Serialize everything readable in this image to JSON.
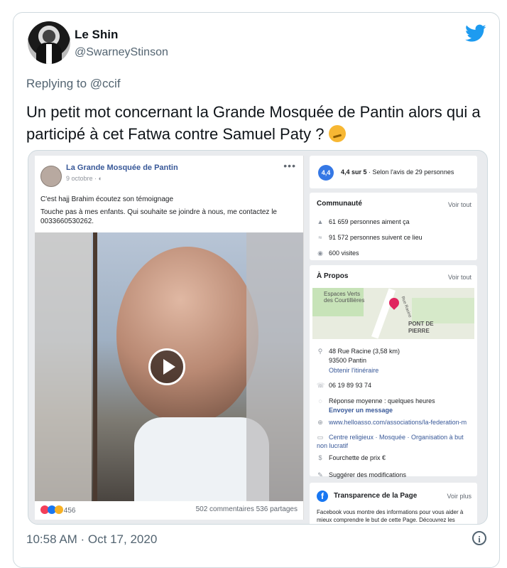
{
  "tweet": {
    "author_name": "Le Shin",
    "author_handle": "@SwarneyStinson",
    "replying_prefix": "Replying to ",
    "replying_to": "@ccif",
    "text": "Un petit mot concernant la Grande Mosquée de Pantin alors qui a participé à cet Fatwa contre Samuel Paty ?",
    "timestamp": "10:58 AM · Oct 17, 2020",
    "info_glyph": "i"
  },
  "screenshot": {
    "post": {
      "page_name": "La Grande Mosquée de Pantin",
      "date": "9 octobre · ",
      "menu": "•••",
      "line1": "C'est hajj Brahim écoutez son témoignage",
      "line2": "Touche pas à mes enfants. Qui souhaite se joindre à nous, me contactez le 0033660530262.",
      "reaction_count": "456",
      "counts": "502 commentaires  536 partages"
    },
    "rating": {
      "badge": "4,4",
      "score": "4,4 sur 5",
      "detail": " · Selon l'avis de 29 personnes"
    },
    "community": {
      "title": "Communauté",
      "see_all": "Voir tout",
      "likes": "61 659 personnes aiment ça",
      "follows": "91 572 personnes suivent ce lieu",
      "visits": "600 visites"
    },
    "about": {
      "title": "À Propos",
      "see_all": "Voir tout",
      "map_label_1": "Espaces Verts des Courtillières",
      "map_label_2": "PONT DE PIERRE",
      "map_label_3": "Rue Racine",
      "address": "48 Rue Racine (3,58 km)",
      "city": "93500 Pantin",
      "directions": "Obtenir l'itinéraire",
      "phone": "06 19 89 93 74",
      "response": "Réponse moyenne : quelques heures",
      "message": "Envoyer un message",
      "website": "www.helloasso.com/associations/la-federation-m",
      "category": "Centre religieux · Mosquée · Organisation à but non lucratif",
      "price": "Fourchette de prix €",
      "suggest": "Suggérer des modifications"
    },
    "transparency": {
      "title": "Transparence de la Page",
      "see_more": "Voir plus",
      "text": "Facebook vous montre des informations pour vous aider à mieux comprendre le but de cette Page. Découvrez les"
    }
  },
  "colors": {
    "twitter_blue": "#1d9bf0",
    "facebook_blue": "#1877f2",
    "link_blue": "#385898"
  },
  "icons": [
    "twitter-bird-icon",
    "play-icon",
    "info-icon",
    "map-pin-icon"
  ]
}
